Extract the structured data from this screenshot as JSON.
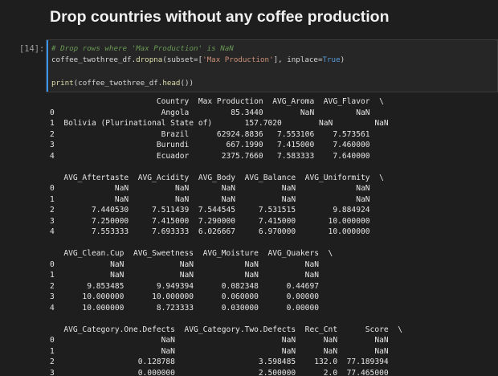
{
  "heading": "Drop countries without any coffee production",
  "cell": {
    "prompt": "[14]:",
    "code": {
      "comment": "# Drop rows where 'Max Production' is NaN",
      "l2_a": "coffee_twothree_df.",
      "l2_method": "dropna",
      "l2_b": "(subset=[",
      "l2_str": "'Max Production'",
      "l2_c": "], inplace=",
      "l2_bool": "True",
      "l2_d": ")",
      "l4_print": "print",
      "l4_a": "(coffee_twothree_df.",
      "l4_method": "head",
      "l4_b": "())"
    }
  },
  "output": {
    "text": "                       Country  Max Production  AVG_Aroma  AVG_Flavor  \\\n0                       Angola         85.3440        NaN         NaN   \n1  Bolivia (Plurinational State of)       157.7020        NaN         NaN   \n2                       Brazil      62924.8836   7.553106    7.573561   \n3                      Burundi        667.1990   7.415000    7.460000   \n4                      Ecuador       2375.7660   7.583333    7.640000   \n\n   AVG_Aftertaste  AVG_Acidity  AVG_Body  AVG_Balance  AVG_Uniformity  \\\n0             NaN          NaN       NaN          NaN             NaN   \n1             NaN          NaN       NaN          NaN             NaN   \n2        7.440530     7.511439  7.544545     7.531515        9.884924   \n3        7.250000     7.415000  7.290000     7.415000       10.000000   \n4        7.553333     7.693333  6.026667     6.970000       10.000000   \n\n   AVG_Clean.Cup  AVG_Sweetness  AVG_Moisture  AVG_Quakers  \\\n0            NaN            NaN           NaN          NaN   \n1            NaN            NaN           NaN          NaN   \n2       9.853485       9.949394      0.082348      0.44697   \n3      10.000000      10.000000      0.060000      0.00000   \n4      10.000000       8.723333      0.030000      0.00000   \n\n   AVG_Category.One.Defects  AVG_Category.Two.Defects  Rec_Cnt      Score  \\\n0                       NaN                       NaN      NaN        NaN   \n1                       NaN                       NaN      NaN        NaN   \n2                  0.128788                  3.598485    132.0  77.189394   \n3                  0.000000                  2.500000      2.0  77.465000   "
  }
}
